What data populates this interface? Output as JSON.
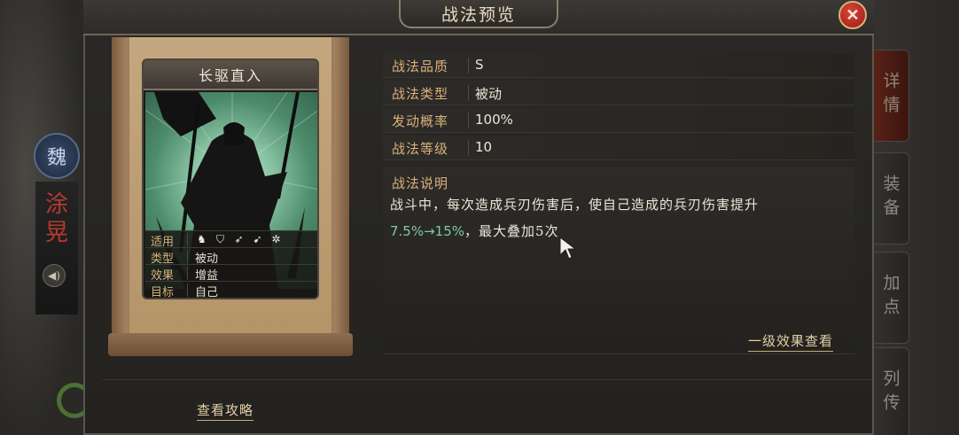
{
  "window": {
    "title": "战法预览",
    "close_label": "✕"
  },
  "hero": {
    "faction": "魏",
    "name": "涂\n晃"
  },
  "side_tabs": [
    {
      "label": "详情",
      "active": true
    },
    {
      "label": "装备",
      "active": false
    },
    {
      "label": "加点",
      "active": false
    },
    {
      "label": "列传",
      "active": false
    }
  ],
  "card": {
    "name": "长驱直入",
    "rows": [
      {
        "key": "适用",
        "value": ""
      },
      {
        "key": "类型",
        "value": "被动"
      },
      {
        "key": "效果",
        "value": "增益"
      },
      {
        "key": "目标",
        "value": "自己"
      }
    ],
    "troop_icons": [
      "cavalry-icon",
      "shield-icon",
      "bow-icon",
      "spear-icon",
      "wheel-icon"
    ]
  },
  "attributes": [
    {
      "key": "战法品质",
      "value": "S"
    },
    {
      "key": "战法类型",
      "value": "被动"
    },
    {
      "key": "发动概率",
      "value": "100%"
    },
    {
      "key": "战法等级",
      "value": "10"
    }
  ],
  "description": {
    "title": "战法说明",
    "line1": "战斗中，每次造成兵刃伤害后，使自己造成的兵刃伤害提升",
    "line2_highlight": "7.5%→15%",
    "line2_rest": "，最大叠加5次",
    "first_level_link": "一级效果查看"
  },
  "footer": {
    "guide_link": "查看攻略"
  },
  "colors": {
    "accent_gold": "#d9b27a",
    "highlight_green": "#7fc7a2",
    "close_red": "#c8332b"
  }
}
